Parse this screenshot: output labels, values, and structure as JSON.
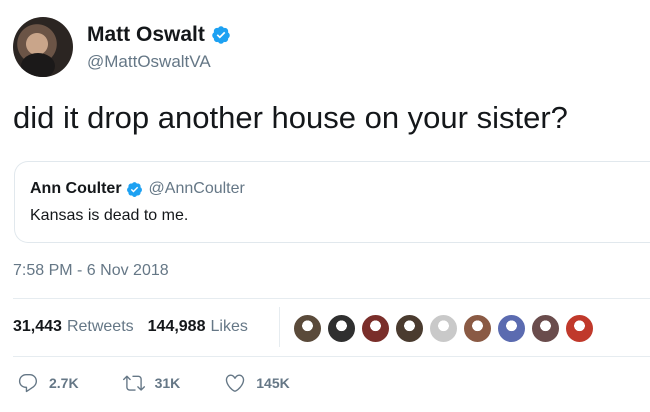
{
  "author": {
    "display_name": "Matt Oswalt",
    "handle": "@MattOswaltVA",
    "verified": true
  },
  "tweet_text": "did it drop another house on your sister?",
  "quoted_tweet": {
    "display_name": "Ann Coulter",
    "handle": "@AnnCoulter",
    "verified": true,
    "text": "Kansas is dead to me."
  },
  "timestamp": "7:58 PM - 6 Nov 2018",
  "stats": {
    "retweets_count": "31,443",
    "retweets_label": "Retweets",
    "likes_count": "144,988",
    "likes_label": "Likes"
  },
  "likers": [
    {
      "color": "#5a4a3a"
    },
    {
      "color": "#2f2f2f"
    },
    {
      "color": "#7a2e2a"
    },
    {
      "color": "#4a3b2f"
    },
    {
      "color": "#c9c9c9"
    },
    {
      "color": "#8a5a44"
    },
    {
      "color": "#5b6bb0"
    },
    {
      "color": "#6a4c4c"
    },
    {
      "color": "#c0392b"
    }
  ],
  "actions": {
    "reply_count": "2.7K",
    "retweet_count": "31K",
    "like_count": "145K"
  },
  "colors": {
    "verified_blue": "#1da1f2",
    "muted": "#657786",
    "text": "#14171a",
    "border": "#e1e8ed"
  },
  "icons": {
    "verified": "verified-badge-icon",
    "reply": "reply-icon",
    "retweet": "retweet-icon",
    "like": "heart-icon"
  }
}
